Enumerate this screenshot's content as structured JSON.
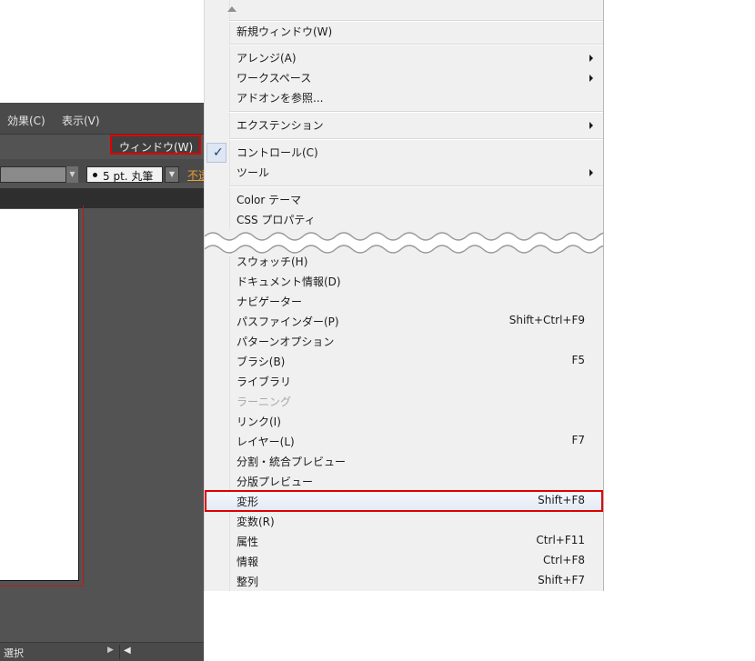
{
  "app": {
    "menubar": {
      "effect": "効果(C)",
      "view": "表示(V)",
      "window": "ウィンドウ(W)"
    },
    "brush": "5 pt. 丸筆",
    "opacity_link": "不透",
    "status": "選択"
  },
  "menu": {
    "items": [
      {
        "label": "新規ウィンドウ(W)"
      },
      {
        "label": "アレンジ(A)",
        "submenu": true
      },
      {
        "label": "ワークスペース",
        "submenu": true
      },
      {
        "label": "アドオンを参照..."
      },
      {
        "label": "エクステンション",
        "submenu": true
      },
      {
        "label": "コントロール(C)",
        "checked": true
      },
      {
        "label": "ツール",
        "submenu": true
      },
      {
        "label": "Color テーマ"
      },
      {
        "label": "CSS プロパティ"
      },
      {
        "label": "スウォッチ(H)"
      },
      {
        "label": "ドキュメント情報(D)"
      },
      {
        "label": "ナビゲーター"
      },
      {
        "label": "パスファインダー(P)",
        "shortcut": "Shift+Ctrl+F9"
      },
      {
        "label": "パターンオプション"
      },
      {
        "label": "ブラシ(B)",
        "shortcut": "F5"
      },
      {
        "label": "ライブラリ"
      },
      {
        "label": "ラーニング",
        "disabled": true
      },
      {
        "label": "リンク(I)"
      },
      {
        "label": "レイヤー(L)",
        "shortcut": "F7"
      },
      {
        "label": "分割・統合プレビュー"
      },
      {
        "label": "分版プレビュー"
      },
      {
        "label": "変形",
        "shortcut": "Shift+F8",
        "highlighted": true
      },
      {
        "label": "変数(R)"
      },
      {
        "label": "属性",
        "shortcut": "Ctrl+F11"
      },
      {
        "label": "情報",
        "shortcut": "Ctrl+F8"
      },
      {
        "label": "整列",
        "shortcut": "Shift+F7"
      }
    ]
  }
}
